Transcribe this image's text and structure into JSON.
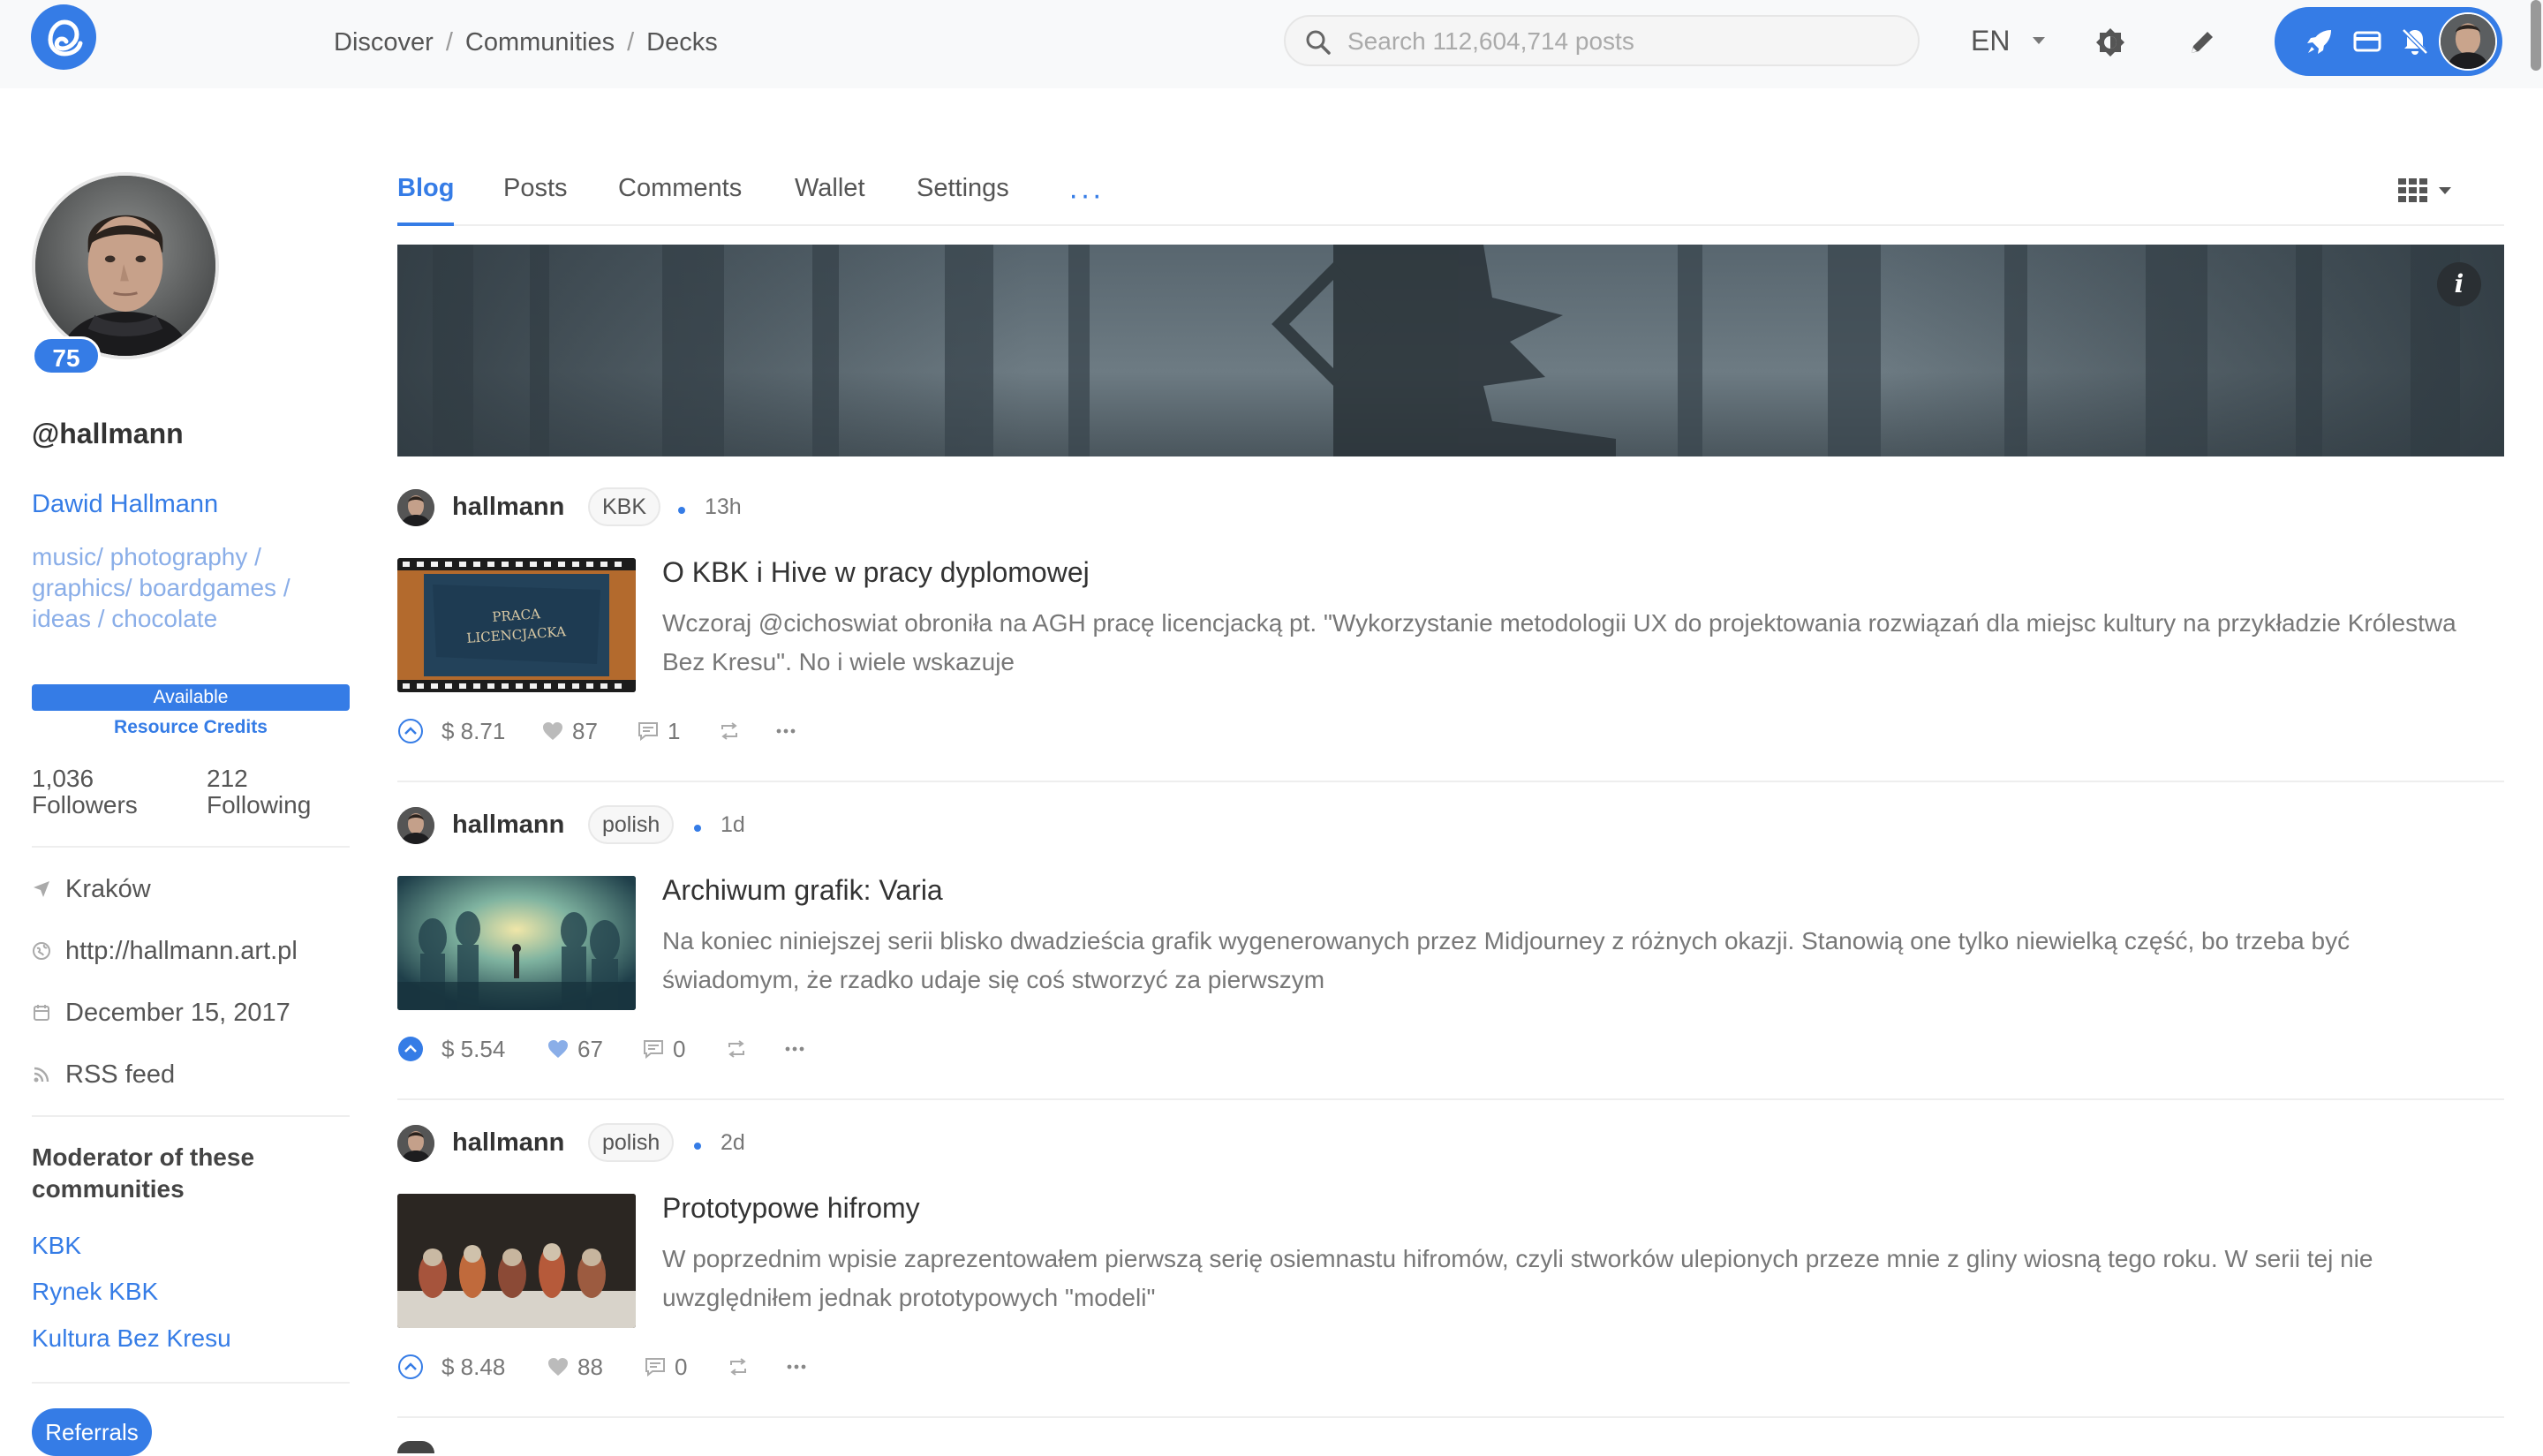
{
  "header": {
    "breadcrumbs": [
      "Discover",
      "Communities",
      "Decks"
    ],
    "breadcrumb_separator": "/",
    "search_placeholder": "Search 112,604,714 posts",
    "language": "EN"
  },
  "profile": {
    "reputation": "75",
    "handle": "@hallmann",
    "name": "Dawid Hallmann",
    "about": "music/ photography / graphics/ boardgames / ideas / chocolate",
    "resource_credits_status": "Available",
    "resource_credits_label": "Resource Credits",
    "followers_count": "1,036",
    "followers_label": "Followers",
    "following_count": "212",
    "following_label": "Following",
    "location": "Kraków",
    "website": "http://hallmann.art.pl",
    "joined": "December 15, 2017",
    "rss": "RSS feed",
    "moderator_title": "Moderator of these communities",
    "communities": [
      "KBK",
      "Rynek KBK",
      "Kultura Bez Kresu"
    ],
    "referrals_label": "Referrals"
  },
  "tabs": [
    "Blog",
    "Posts",
    "Comments",
    "Wallet",
    "Settings"
  ],
  "tab_more": "···",
  "active_tab": "Blog",
  "cover_info": "i",
  "posts": [
    {
      "author": "hallmann",
      "community": "KBK",
      "age": "13h",
      "title": "O KBK i Hive w pracy dyplomowej",
      "excerpt": "Wczoraj @cichoswiat obroniła na AGH pracę licencjacką pt. \"Wykorzystanie metodologii UX do projektowania rozwiązań dla miejsc kultury na przykładzie Królestwa Bez Kresu\". No i wiele wskazuje",
      "payout": "$ 8.71",
      "votes": "87",
      "comments": "1",
      "voted": false,
      "thumb_text": [
        "PRACA",
        "LICENCJACKA"
      ]
    },
    {
      "author": "hallmann",
      "community": "polish",
      "age": "1d",
      "title": "Archiwum grafik: Varia",
      "excerpt": "Na koniec niniejszej serii blisko dwadzieścia grafik wygenerowanych przez Midjourney z różnych okazji. Stanowią one tylko niewielką część, bo trzeba być świadomym, że rzadko udaje się coś stworzyć za pierwszym",
      "payout": "$ 5.54",
      "votes": "67",
      "comments": "0",
      "voted": true
    },
    {
      "author": "hallmann",
      "community": "polish",
      "age": "2d",
      "title": "Prototypowe hifromy",
      "excerpt": "W poprzednim wpisie zaprezentowałem pierwszą serię osiemnastu hifromów, czyli stworków ulepionych przeze mnie z gliny wiosną tego roku. W serii tej nie uwzględniłem jednak prototypowych \"modeli\"",
      "payout": "$ 8.48",
      "votes": "88",
      "comments": "0",
      "voted": false
    }
  ],
  "colors": {
    "accent": "#357ce6",
    "muted_link": "#8aaee8",
    "text": "#333333",
    "muted_text": "#777777",
    "topbar_bg": "#f8f9fa"
  },
  "icons": {
    "logo": "hive-blog-logo",
    "search": "search-icon",
    "theme": "theme-toggle-icon",
    "edit": "pencil-icon",
    "rocket": "rocket-icon",
    "wallet": "credit-card-icon",
    "notifications": "bell-off-icon",
    "location": "location-arrow-icon",
    "website": "globe-icon",
    "joined": "calendar-icon",
    "rss": "rss-icon",
    "grid": "grid-view-icon",
    "upvote": "upvote-icon",
    "heart": "heart-icon",
    "comment": "comment-icon",
    "reblog": "reblog-icon",
    "more": "more-icon"
  }
}
